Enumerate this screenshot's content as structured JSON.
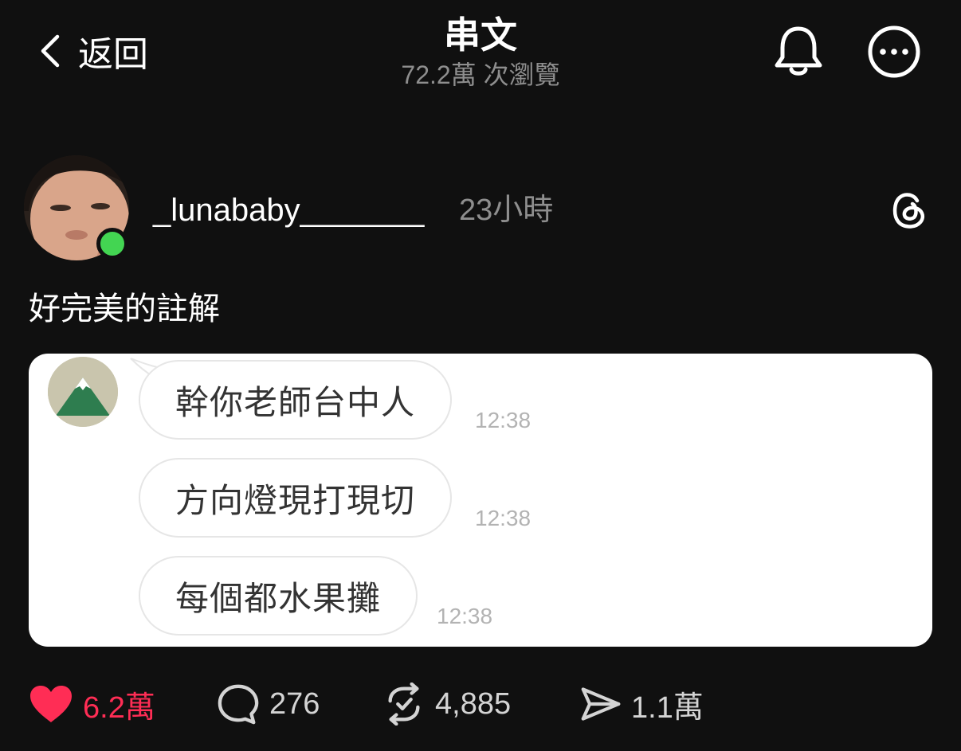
{
  "header": {
    "back_label": "返回",
    "title": "串文",
    "view_count": "72.2萬 次瀏覽"
  },
  "post": {
    "username": "_lunababy_______",
    "time": "23小時",
    "text": "好完美的註解",
    "online": true
  },
  "embedded_chat": {
    "messages": [
      {
        "text": "幹你老師台中人",
        "time": "12:38"
      },
      {
        "text": "方向燈現打現切",
        "time": "12:38"
      },
      {
        "text": "每個都水果攤",
        "time": "12:38"
      }
    ]
  },
  "actions": {
    "likes": "6.2萬",
    "comments": "276",
    "reposts": "4,885",
    "shares": "1.1萬"
  },
  "colors": {
    "background": "#101010",
    "like_red": "#ff2d55",
    "online_green": "#43d552",
    "muted_text": "#8e8e8e"
  },
  "icons": [
    "chevron-left-icon",
    "bell-icon",
    "more-icon",
    "threads-logo-icon",
    "heart-icon",
    "comment-icon",
    "repost-icon",
    "send-icon"
  ]
}
